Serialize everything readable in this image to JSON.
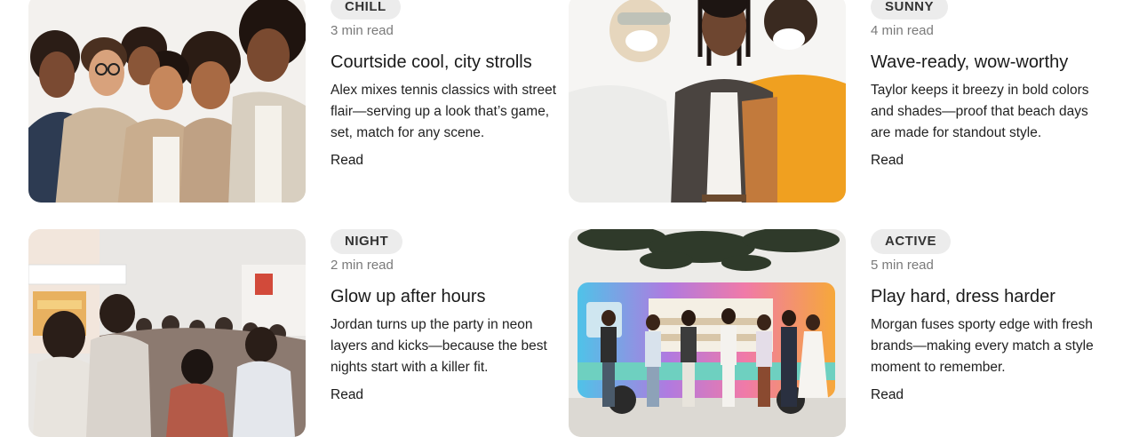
{
  "cards": [
    {
      "tag": "CHILL",
      "meta": "3 min read",
      "title": "Courtside cool, city strolls",
      "desc": "Alex mixes tennis classics with street flair—serving up a look that’s game, set, match for any scene.",
      "read": "Read"
    },
    {
      "tag": "SUNNY",
      "meta": "4 min read",
      "title": "Wave-ready, wow-worthy",
      "desc": "Taylor keeps it breezy in bold colors and shades—proof that beach days are made for standout style.",
      "read": "Read"
    },
    {
      "tag": "NIGHT",
      "meta": "2 min read",
      "title": "Glow up after hours",
      "desc": "Jordan turns up the party in neon layers and kicks—because the best nights start with a killer fit.",
      "read": "Read"
    },
    {
      "tag": "ACTIVE",
      "meta": "5 min read",
      "title": "Play hard, dress harder",
      "desc": "Morgan fuses sporty edge with fresh brands—making every match a style moment to remember.",
      "read": "Read"
    }
  ]
}
